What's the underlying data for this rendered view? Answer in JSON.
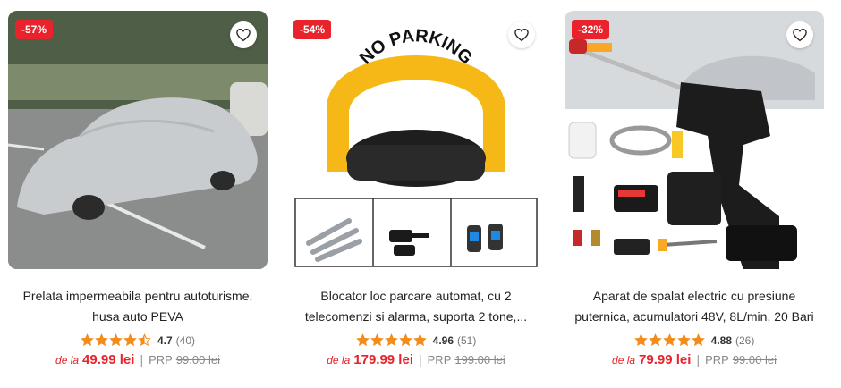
{
  "products": [
    {
      "discount": "-57%",
      "title_lines": [
        "Prelata impermeabila pentru autoturisme,",
        "husa auto PEVA"
      ],
      "rating": "4.7",
      "stars": 4.5,
      "reviews": "(40)",
      "price_prefix": "de la",
      "price": "49.99 lei",
      "prp_label": "PRP",
      "old_price": "99.00 lei",
      "image_icon": "car-cover-image"
    },
    {
      "discount": "-54%",
      "title_lines": [
        "Blocator loc parcare automat, cu 2",
        "telecomenzi si alarma, suporta 2 tone,..."
      ],
      "rating": "4.96",
      "stars": 5,
      "reviews": "(51)",
      "price_prefix": "de la",
      "price": "179.99 lei",
      "prp_label": "PRP",
      "old_price": "199.00 lei",
      "image_icon": "parking-blocker-image",
      "image_text": "NO PARKING"
    },
    {
      "discount": "-32%",
      "title_lines": [
        "Aparat de spalat electric cu presiune",
        "puternica, acumulatori 48V, 8L/min, 20 Bari"
      ],
      "rating": "4.88",
      "stars": 5,
      "reviews": "(26)",
      "price_prefix": "de la",
      "price": "79.99 lei",
      "prp_label": "PRP",
      "old_price": "99.00 lei",
      "image_icon": "pressure-washer-image"
    }
  ],
  "colors": {
    "accent": "#e8232b",
    "star": "#f28c1b"
  }
}
